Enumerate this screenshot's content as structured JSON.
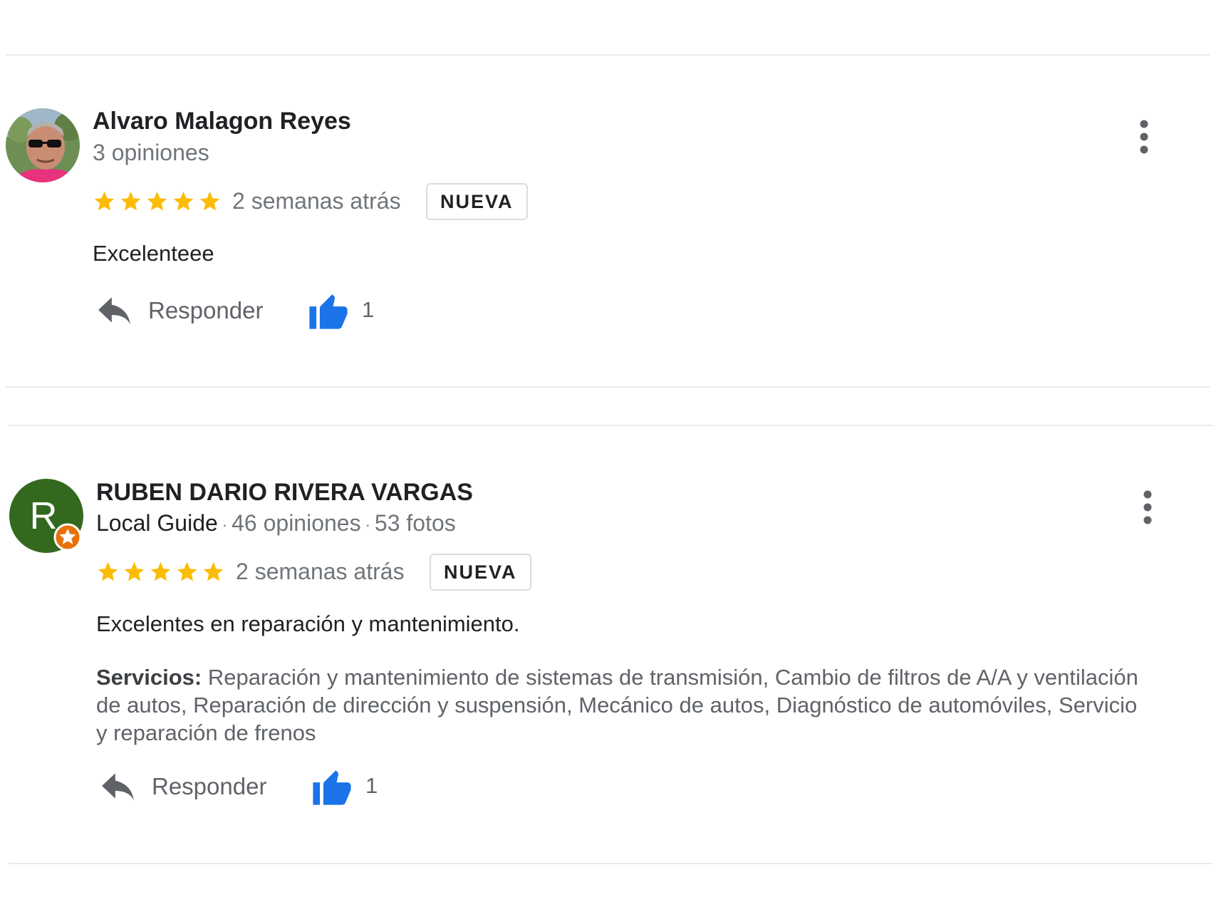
{
  "reviews": [
    {
      "name": "Alvaro Malagon Reyes",
      "stats": "3 opiniones",
      "rating": 5,
      "time": "2 semanas atrás",
      "badge": "NUEVA",
      "text": "Excelenteee",
      "reply_label": "Responder",
      "likes": "1"
    },
    {
      "name": "RUBEN DARIO RIVERA VARGAS",
      "avatar_letter": "R",
      "local_guide": "Local Guide",
      "reviews_count": "46 opiniones",
      "photos_count": "53 fotos",
      "separator": "·",
      "rating": 5,
      "time": "2 semanas atrás",
      "badge": "NUEVA",
      "text": "Excelentes en reparación y mantenimiento.",
      "services_label": "Servicios:",
      "services_text": "Reparación y mantenimiento de sistemas de transmisión, Cambio de filtros de A/A y ventilación de autos, Reparación de dirección y suspensión, Mecánico de autos, Diagnóstico de automóviles, Servicio y reparación de frenos",
      "reply_label": "Responder",
      "likes": "1"
    }
  ],
  "colors": {
    "star": "#fbbc04",
    "like": "#1a73e8",
    "avatar_green": "#33691e",
    "guide_badge": "#e8710a"
  },
  "icons": [
    "star-icon",
    "reply-icon",
    "thumbs-up-icon",
    "more-vert-icon",
    "local-guide-star-icon"
  ]
}
